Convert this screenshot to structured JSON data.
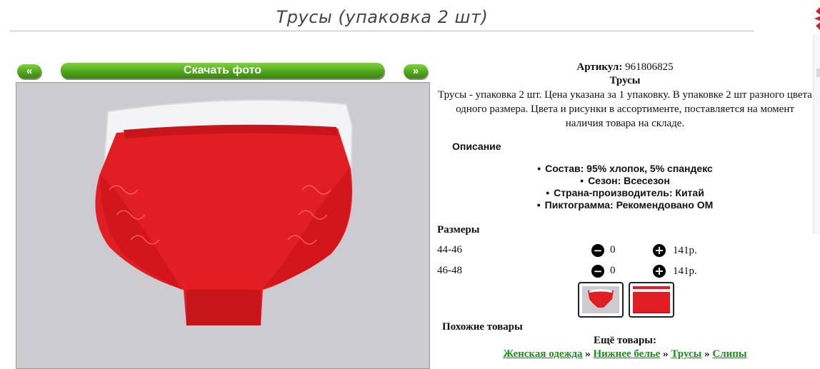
{
  "title": "Трусы (упаковка 2 шт)",
  "gallery": {
    "prev_label": "«",
    "download_label": "Скачать фото",
    "next_label": "»",
    "photo_icon": "product-photo-red-briefs",
    "accent_color": "#4ea21b"
  },
  "product": {
    "article_label": "Артикул:",
    "article_value": "961806825",
    "name": "Трусы",
    "description": "Трусы - упаковка 2 шт. Цена указана за 1 упаковку. В упаковке 2 шт разного цвета одного размера. Цвета и рисунки в ассортименте, поставляется на момент наличия товара на складе."
  },
  "features": {
    "heading": "Описание",
    "items": [
      "Состав: 95% хлопок, 5% спандекс",
      "Сезон: Всесезон",
      "Страна-производитель: Китай",
      "Пиктограмма: Рекомендовано ОМ"
    ]
  },
  "sizes": {
    "heading": "Размеры",
    "rows": [
      {
        "size": "44-46",
        "minus_icon": "minus-circle-icon",
        "qty": "0",
        "plus_icon": "plus-circle-icon",
        "price": "141р."
      },
      {
        "size": "46-48",
        "minus_icon": "minus-circle-icon",
        "qty": "0",
        "plus_icon": "plus-circle-icon",
        "price": "141р."
      }
    ]
  },
  "similar": {
    "heading": "Похожие товары",
    "more_heading": "Ещё товары:",
    "breadcrumbs": [
      "Женская одежда",
      "Нижнее белье",
      "Трусы",
      "Слипы"
    ],
    "separator": "»",
    "link_color": "#1f8a1f"
  }
}
